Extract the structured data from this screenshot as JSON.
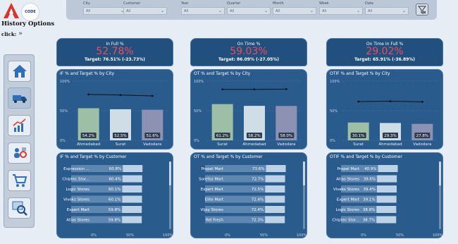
{
  "header": {
    "history_title": "History Options",
    "history_click": "click:",
    "logo_code_text": "CODE"
  },
  "filters": [
    {
      "label": "City",
      "value": "All"
    },
    {
      "label": "Customer",
      "value": "All"
    },
    {
      "label": "Year",
      "value": "All"
    },
    {
      "label": "Quarter",
      "value": "All"
    },
    {
      "label": "Month",
      "value": "All"
    },
    {
      "label": "Week",
      "value": "All"
    },
    {
      "label": "Date",
      "value": "All"
    }
  ],
  "nav": [
    "home-icon",
    "delivery-truck-icon",
    "growth-chart-icon",
    "team-settings-icon",
    "cart-icon",
    "search-analytics-icon"
  ],
  "columns": [
    {
      "kpi_title": "In Full %",
      "kpi_value": "52.78%",
      "kpi_target": "Target: 76.51% (-23.73%)",
      "city_title": "IF % and Target % by City",
      "cust_title": "IF % and Target % by Customer"
    },
    {
      "kpi_title": "On Time %",
      "kpi_value": "59.03%",
      "kpi_target": "Target: 86.09% (-27.05%)",
      "city_title": "OT % and Target % by City",
      "cust_title": "OT % and Target % by Customer"
    },
    {
      "kpi_title": "On Time In Full %",
      "kpi_value": "29.02%",
      "kpi_target": "Target: 65.91% (-36.89%)",
      "city_title": "OTIF % and Target % by City",
      "cust_title": "OTIF % and Target % by Customer"
    }
  ],
  "colors": {
    "bar_green": "#9cbfa5",
    "bar_light": "#cfdde6",
    "bar_purple": "#8d92b5",
    "bar_blue": "#bcd2e6",
    "panel": "#2a5b8d",
    "kpi_value": "#ee4b5e"
  },
  "chart_data": [
    {
      "type": "bar",
      "title": "IF % and Target % by City",
      "categories": [
        "Ahmedabad",
        "Surat",
        "Vadodara"
      ],
      "values": [
        54.2,
        52.5,
        51.6
      ],
      "labels": [
        "54.2%",
        "52.5%",
        "51.6%"
      ],
      "target": [
        77.5,
        76.5,
        75.0
      ],
      "ylim": [
        0,
        100
      ],
      "yticks": [
        "0%",
        "50%",
        "100%"
      ]
    },
    {
      "type": "bar",
      "title": "OT % and Target % by City",
      "categories": [
        "Surat",
        "Ahmedabad",
        "Vadodara"
      ],
      "values": [
        61.2,
        58.2,
        58.0
      ],
      "labels": [
        "61.2%",
        "58.2%",
        "58.0%"
      ],
      "target": [
        86.0,
        86.0,
        86.5
      ],
      "ylim": [
        0,
        100
      ],
      "yticks": [
        "0%",
        "50%",
        "100%"
      ]
    },
    {
      "type": "bar",
      "title": "OTIF % and Target % by City",
      "categories": [
        "Surat",
        "Ahmedabad",
        "Vadodara"
      ],
      "values": [
        30.1,
        29.3,
        27.8
      ],
      "labels": [
        "30.1%",
        "29.3%",
        "27.8%"
      ],
      "target": [
        65.5,
        66.0,
        65.0
      ],
      "ylim": [
        0,
        100
      ],
      "yticks": [
        "0%",
        "50%",
        "100%"
      ]
    },
    {
      "type": "bar",
      "title": "IF % and Target % by Customer",
      "categories": [
        "Expression ...",
        "Chiptec Stor...",
        "Logic Stores",
        "Viveks Stores",
        "Expert Mart",
        "Atlas Stores"
      ],
      "values": [
        60.8,
        60.4,
        60.1,
        60.1,
        59.8,
        59.8
      ],
      "labels": [
        "60.8%",
        "60.4%",
        "60.1%",
        "60.1%",
        "59.8%",
        "59.8%"
      ],
      "xticks": [
        "0%",
        "50%",
        "100%"
      ]
    },
    {
      "type": "bar",
      "title": "OT % and Target % by Customer",
      "categories": [
        "Propel Mart",
        "Sorefoz Mart",
        "Expert Mart",
        "Elite Mart",
        "Vijay Stores",
        "Rel Fresh"
      ],
      "values": [
        73.6,
        72.7,
        72.5,
        72.4,
        72.4,
        72.3
      ],
      "labels": [
        "73.6%",
        "72.7%",
        "72.5%",
        "72.4%",
        "72.4%",
        "72.3%"
      ],
      "xticks": [
        "0%",
        "50%",
        "100%"
      ]
    },
    {
      "type": "bar",
      "title": "OTIF % and Target % by Customer",
      "categories": [
        "Propel Mart",
        "Atlas Stores",
        "Viveks Stores",
        "Expert Mart",
        "Logic Stores",
        "Chiptec Stor..."
      ],
      "values": [
        40.9,
        39.6,
        39.4,
        39.1,
        38.8,
        38.7
      ],
      "labels": [
        "40.9%",
        "39.6%",
        "39.4%",
        "39.1%",
        "38.8%",
        "38.7%"
      ],
      "xticks": [
        "0%",
        "50%",
        "100%"
      ]
    }
  ]
}
